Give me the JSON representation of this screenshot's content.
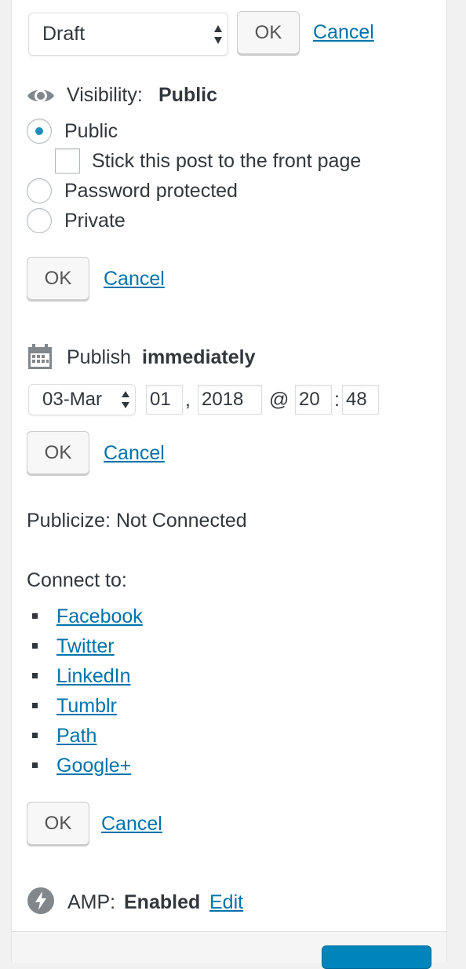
{
  "status": {
    "select_value": "Draft",
    "ok_label": "OK",
    "cancel_label": "Cancel"
  },
  "visibility": {
    "label": "Visibility:",
    "value": "Public",
    "options": [
      {
        "label": "Public",
        "checked": true
      },
      {
        "label": "Password protected",
        "checked": false
      },
      {
        "label": "Private",
        "checked": false
      }
    ],
    "sticky_label": "Stick this post to the front page",
    "ok_label": "OK",
    "cancel_label": "Cancel"
  },
  "publish": {
    "label": "Publish",
    "value": "immediately",
    "month_value": "03-Mar",
    "day_value": "01",
    "comma": ",",
    "year_value": "2018",
    "at_sign": "@",
    "hour_value": "20",
    "colon": ":",
    "minute_value": "48",
    "ok_label": "OK",
    "cancel_label": "Cancel"
  },
  "publicize": {
    "status_text": "Publicize: Not Connected",
    "connect_label": "Connect to:",
    "services": [
      "Facebook",
      "Twitter",
      "LinkedIn",
      "Tumblr",
      "Path",
      "Google+"
    ],
    "ok_label": "OK",
    "cancel_label": "Cancel"
  },
  "amp": {
    "label": "AMP:",
    "value": "Enabled",
    "edit_label": "Edit"
  },
  "icons": {
    "visibility": "eye-icon",
    "publish": "calendar-icon",
    "amp": "lightning-icon"
  },
  "colors": {
    "link": "#0073aa",
    "radio_checked": "#1e8cbe",
    "primary_button": "#0085ba",
    "icon_gray": "#82878c"
  }
}
